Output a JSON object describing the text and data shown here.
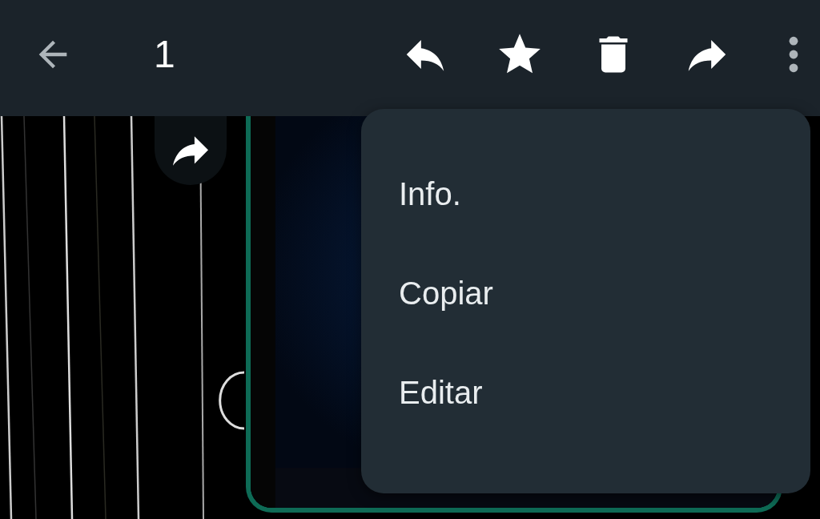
{
  "toolbar": {
    "selection_count": "1"
  },
  "message": {
    "kind": "picture",
    "selected": true
  },
  "menu": {
    "items": [
      {
        "label": "Info."
      },
      {
        "label": "Copiar"
      },
      {
        "label": "Editar"
      }
    ]
  }
}
